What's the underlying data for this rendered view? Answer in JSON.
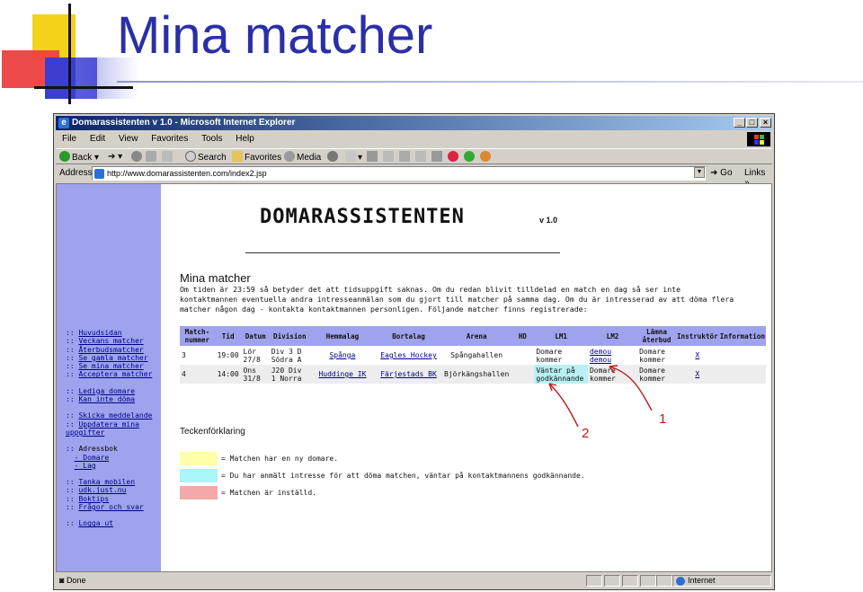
{
  "slide": {
    "title": "Mina matcher"
  },
  "browser": {
    "window_title": "Domarassistenten v 1.0 - Microsoft Internet Explorer",
    "menu": [
      "File",
      "Edit",
      "View",
      "Favorites",
      "Tools",
      "Help"
    ],
    "toolbar": {
      "back": "Back",
      "search": "Search",
      "favorites": "Favorites",
      "media": "Media"
    },
    "address_label": "Address",
    "address_url": "http://www.domarassistenten.com/index2.jsp",
    "go_label": "Go",
    "links_label": "Links",
    "status_text": "Done",
    "zone_text": "Internet"
  },
  "sidebar": {
    "groups": [
      [
        "Huvudsidan",
        "Veckans matcher",
        "Återbudsmatcher",
        "Se gamla matcher",
        "Se mina matcher",
        "Acceptera matcher"
      ],
      [
        "Lediga domare",
        "Kan inte döma"
      ],
      [
        "Skicka meddelande",
        "Uppdatera mina uppgifter"
      ]
    ],
    "adressbok_label": "Adressbok",
    "adressbok_items": [
      "- Domare",
      "- Lag"
    ],
    "groups2": [
      [
        "Tanka mobilen",
        "udk.just.nu",
        "Boktips",
        "Frågor och svar"
      ],
      [
        "Logga ut"
      ]
    ]
  },
  "page": {
    "logo_text": "DOMARASSISTENTEN",
    "logo_version": "v 1.0",
    "heading": "Mina matcher",
    "intro": "Om tiden är 23:59 så betyder det att tidsuppgift saknas. Om du redan blivit tilldelad en match en dag så ser inte kontaktmannen eventuella andra intresseanmälan som du gjort till matcher på samma dag. Om du är intresserad av att döma flera matcher någon dag - kontakta kontaktmannen personligen. Följande matcher finns registrerade:"
  },
  "table": {
    "headers": [
      "Match-nummer",
      "Tid",
      "Datum",
      "Division",
      "Hemmalag",
      "Bortalag",
      "Arena",
      "HD",
      "LM1",
      "LM2",
      "Lämna återbud",
      "Instruktör",
      "Information"
    ],
    "rows": [
      {
        "nr": "3",
        "tid": "19:00",
        "datum": "Lör 27/8",
        "division": "Div 3 D Södra A",
        "hemmalag": "Spånga",
        "bortalag": "Eagles Hockey",
        "arena": "Spångahallen",
        "hd": "",
        "lm1": "Domare kommer",
        "lm2a": "demou",
        "lm2b": "demou",
        "aterbud": "Domare kommer",
        "instruktor": "X",
        "information": ""
      },
      {
        "nr": "4",
        "tid": "14:00",
        "datum": "Ons 31/8",
        "division": "J20 Div 1 Norra",
        "hemmalag": "Huddinge IK",
        "bortalag": "Färjestads BK",
        "arena": "Björkängshallen",
        "hd": "",
        "lm1": "Väntar på godkännande",
        "lm2": "Domare kommer",
        "aterbud": "Domare kommer",
        "instruktor": "X",
        "information": ""
      }
    ]
  },
  "legend": {
    "title": "Teckenförklaring",
    "items": [
      {
        "color": "#ffffaa",
        "text": "= Matchen har en ny domare."
      },
      {
        "color": "#aaf6f8",
        "text": "= Du har anmält intresse för att döma matchen, väntar på kontaktmannens godkännande."
      },
      {
        "color": "#f3a9a9",
        "text": "= Matchen är inställd."
      }
    ]
  },
  "annotations": {
    "one": "1",
    "two": "2"
  },
  "colors": {
    "title_blue": "#2a2fa8",
    "sidebar_bg": "#9fa3ee",
    "annotation_red": "#c01818"
  }
}
